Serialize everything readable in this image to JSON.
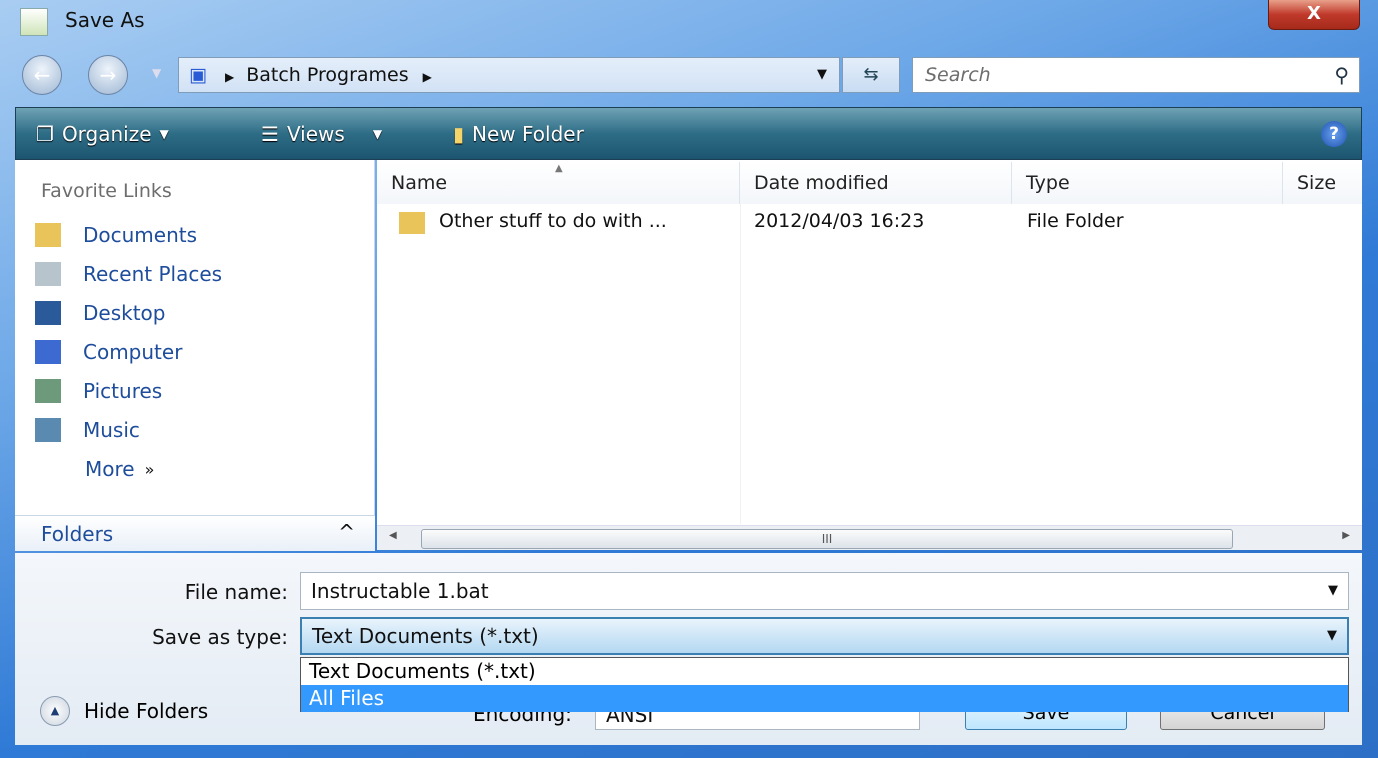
{
  "window": {
    "title": "Save As",
    "close_label": "X"
  },
  "address": {
    "path": [
      "Batch Programes"
    ],
    "search_placeholder": "Search"
  },
  "toolbar": {
    "organize": "Organize",
    "views": "Views",
    "new_folder": "New Folder",
    "help": "?"
  },
  "sidebar": {
    "heading": "Favorite Links",
    "items": [
      {
        "label": "Documents",
        "icon": "documents-folder-icon"
      },
      {
        "label": "Recent Places",
        "icon": "recent-places-icon"
      },
      {
        "label": "Desktop",
        "icon": "desktop-icon"
      },
      {
        "label": "Computer",
        "icon": "computer-icon"
      },
      {
        "label": "Pictures",
        "icon": "pictures-icon"
      },
      {
        "label": "Music",
        "icon": "music-icon"
      }
    ],
    "more": "More",
    "more_glyph": "»",
    "folders": "Folders"
  },
  "columns": [
    "Name",
    "Date modified",
    "Type",
    "Size"
  ],
  "files": [
    {
      "name": "Other stuff to do with ...",
      "date": "2012/04/03 16:23",
      "type": "File Folder",
      "size": ""
    }
  ],
  "scroll_grip": "III",
  "form": {
    "file_name_label": "File name:",
    "file_name": "Instructable 1.bat",
    "type_label": "Save as type:",
    "type_value": "Text Documents (*.txt)",
    "type_options": [
      "Text Documents (*.txt)",
      "All Files"
    ],
    "highlighted_option": "All Files",
    "encoding_label": "Encoding:",
    "encoding_value": "ANSI",
    "save": "Save",
    "cancel": "Cancel",
    "hide_folders": "Hide Folders"
  },
  "colors": {
    "link": "#1e4d9c",
    "highlight": "#3399ff",
    "toolbar": "#2e6d86"
  }
}
